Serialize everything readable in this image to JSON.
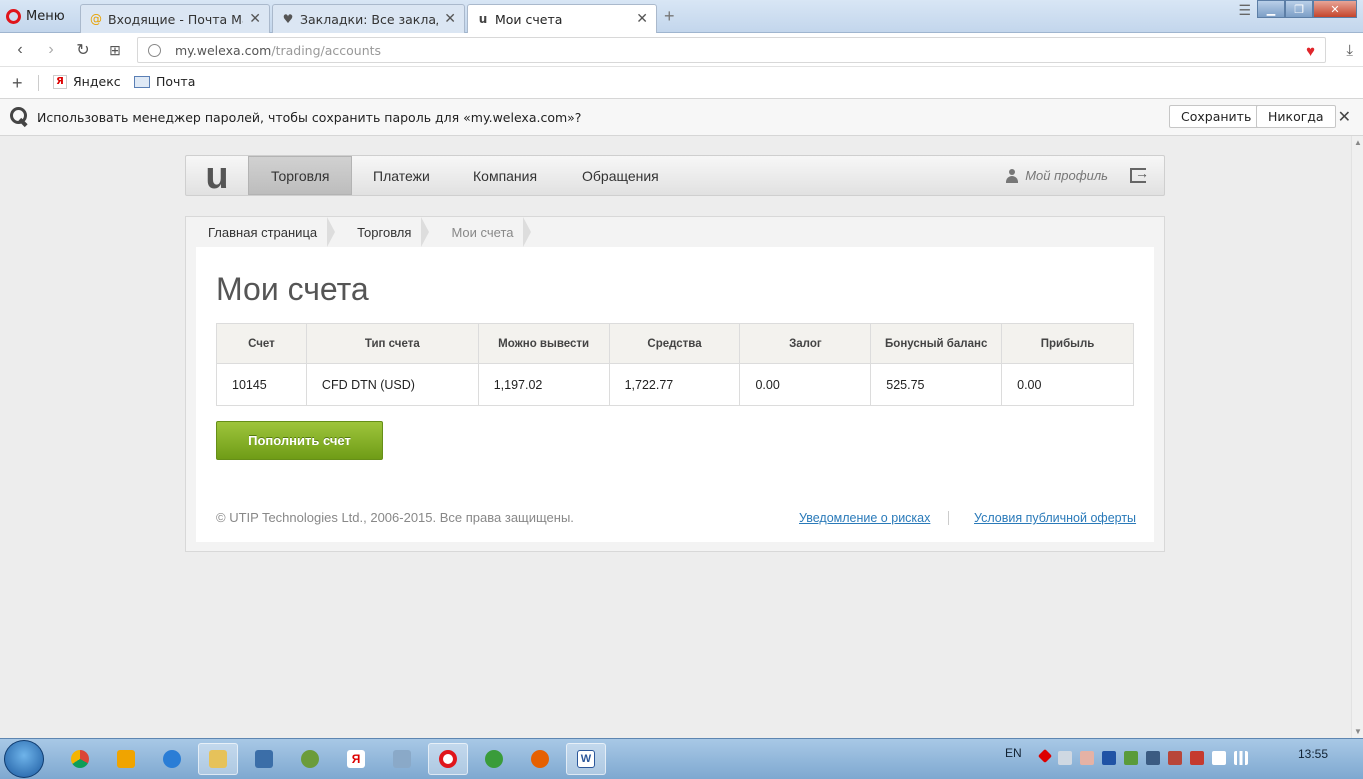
{
  "browser": {
    "menu_label": "Меню",
    "tabs": [
      {
        "title": "Входящие - Почта Mail.Ru",
        "icon": "mailru-at-icon"
      },
      {
        "title": "Закладки: Все закладки",
        "icon": "heart-icon"
      },
      {
        "title": "Мои счета",
        "icon": "utip-logo-icon"
      }
    ],
    "url_host": "my.welexa.com",
    "url_path": "/trading/accounts",
    "bookmarks": [
      "Яндекс",
      "Почта"
    ],
    "password_bar": {
      "text": "Использовать менеджер паролей, чтобы сохранить пароль для «my.welexa.com»?",
      "save": "Сохранить",
      "never": "Никогда"
    }
  },
  "site": {
    "logo": "u",
    "nav": [
      "Торговля",
      "Платежи",
      "Компания",
      "Обращения"
    ],
    "profile": "Мой профиль",
    "breadcrumb": [
      "Главная страница",
      "Торговля",
      "Мои счета"
    ],
    "title": "Мои счета",
    "table": {
      "headers": [
        "Счет",
        "Тип счета",
        "Можно вывести",
        "Средства",
        "Залог",
        "Бонусный баланс",
        "Прибыль"
      ],
      "rows": [
        [
          "10145",
          "CFD DTN (USD)",
          "1,197.02",
          "1,722.77",
          "0.00",
          "525.75",
          "0.00"
        ]
      ]
    },
    "topup_button": "Пополнить счет",
    "footer": {
      "copyright": "© UTIP Technologies Ltd., 2006-2015. Все права защищены.",
      "link1": "Уведомление о рисках",
      "link2": "Условия публичной оферты"
    }
  },
  "taskbar": {
    "lang": "EN",
    "time": "13:55"
  },
  "colors": {
    "accent_green": "#8bb62b",
    "link_blue": "#2a7ab9",
    "opera_red": "#e0151b"
  }
}
